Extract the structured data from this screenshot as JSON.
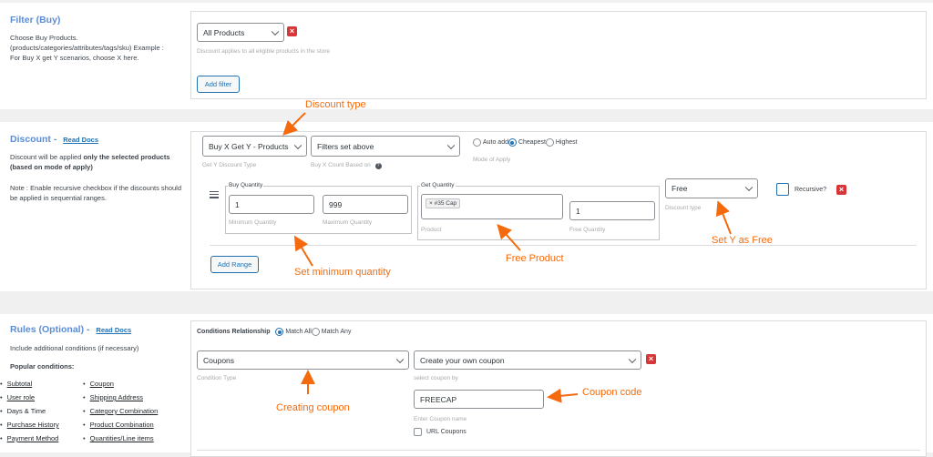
{
  "filter": {
    "heading": "Filter (Buy)",
    "desc": [
      "Choose Buy Products.",
      "(products/categories/attributes/tags/sku) Example :",
      "For Buy X get Y scenarios, choose X here."
    ],
    "select_value": "All Products",
    "hint": "Discount applies to all eligible products in the store",
    "add_filter_label": "Add filter"
  },
  "discount": {
    "heading": "Discount - ",
    "read_docs": "Read Docs",
    "desc_pre": "Discount will be applied ",
    "desc_bold": "only the selected products (based on mode of apply)",
    "note": "Note : Enable recursive checkbox if the discounts should be applied in sequential ranges.",
    "type_value": "Buy X Get Y - Products",
    "type_hint": "Get Y Discount Type",
    "count_value": "Filters set above",
    "count_hint": "Buy X Count Based on",
    "auto_add": "Auto add",
    "cheapest": "Cheapest",
    "highest": "Highest",
    "mode_hint": "Mode of Apply",
    "buy_quantity": "Buy Quantity",
    "min_value": "1",
    "max_value": "999",
    "min_hint": "Minimum Quantity",
    "max_hint": "Maximum Quantity",
    "get_quantity": "Get Quantity",
    "product_tag": "× #35 Cap",
    "product_hint": "Product",
    "free_qty_value": "1",
    "free_qty_hint": "Free Quantity",
    "discount_type_value": "Free",
    "discount_type_hint": "Discount type",
    "recursive": "Recursive?",
    "add_range": "Add Range"
  },
  "rules": {
    "heading": "Rules (Optional) - ",
    "read_docs": "Read Docs",
    "desc": "Include additional conditions (if necessary)",
    "popular": "Popular conditions:",
    "col1": [
      "Subtotal",
      "User role",
      "Days & Time",
      "Purchase History",
      "Payment Method"
    ],
    "col2": [
      "Coupon",
      "Shipping Address",
      "Category Combination",
      "Product Combination",
      "Quantities/Line items"
    ],
    "relationship_label": "Conditions Relationship",
    "match_all": "Match All",
    "match_any": "Match Any",
    "condition_value": "Coupons",
    "condition_hint": "Condition Type",
    "coupon_select_value": "Create your own coupon",
    "coupon_select_hint": "select coupon by",
    "coupon_name_value": "FREECAP",
    "coupon_name_hint": "Enter Coupon name",
    "url_coupons": "URL Coupons"
  },
  "annotations": {
    "discount_type": "Discount type",
    "set_min_qty": "Set minimum quantity",
    "free_product": "Free Product",
    "set_y_free": "Set Y as Free",
    "creating_coupon": "Creating coupon",
    "coupon_code": "Coupon code"
  },
  "colors": {
    "accent": "#2271b1",
    "danger": "#d63638",
    "annotation": "#f56a0c",
    "heading": "#5b8dd6"
  }
}
